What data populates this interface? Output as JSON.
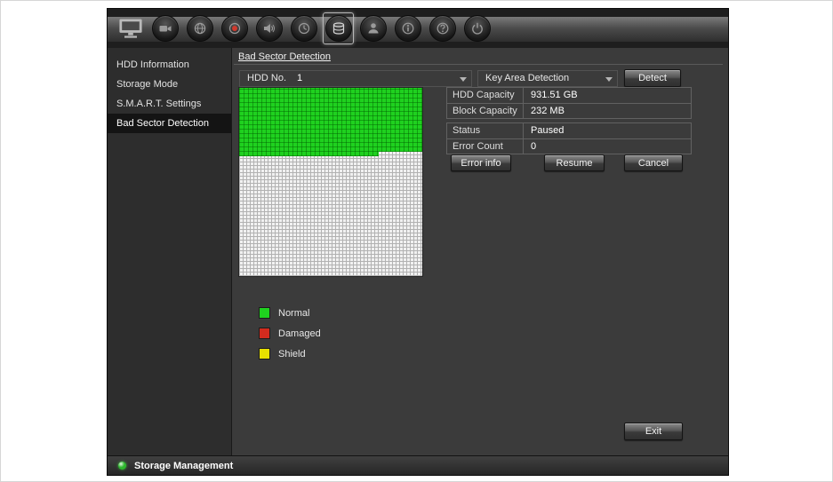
{
  "toolbar": {
    "icons": [
      "display-icon",
      "camera-icon",
      "network-icon",
      "record-icon",
      "alarm-icon",
      "system-icon",
      "storage-icon",
      "user-icon",
      "info-icon",
      "help-icon",
      "power-icon"
    ],
    "selected_icon": "storage-icon"
  },
  "sidebar": {
    "items": [
      {
        "label": "HDD Information",
        "selected": false
      },
      {
        "label": "Storage Mode",
        "selected": false
      },
      {
        "label": "S.M.A.R.T. Settings",
        "selected": false
      },
      {
        "label": "Bad Sector Detection",
        "selected": true
      }
    ]
  },
  "content": {
    "tab_title": "Bad Sector Detection",
    "hdd_row": {
      "label": "HDD No.",
      "value": "1",
      "detection_type": "Key Area Detection",
      "detect_button": "Detect"
    },
    "info": {
      "hdd_capacity_label": "HDD Capacity",
      "hdd_capacity_value": "931.51 GB",
      "block_capacity_label": "Block Capacity",
      "block_capacity_value": "232 MB",
      "status_label": "Status",
      "status_value": "Paused",
      "error_count_label": "Error Count",
      "error_count_value": "0"
    },
    "buttons": {
      "error_info": "Error info",
      "resume": "Resume",
      "cancel": "Cancel",
      "exit": "Exit"
    },
    "legend": [
      {
        "label": "Normal"
      },
      {
        "label": "Damaged"
      },
      {
        "label": "Shield"
      }
    ],
    "grid": {
      "scanned_percent": 34,
      "partial_row_percent": 76
    }
  },
  "colors": {
    "normal": "#1fd11f",
    "damaged": "#d42b1e",
    "shield": "#e8e000",
    "status_led": "#2db82d"
  },
  "statusbar": {
    "label": "Storage Management"
  }
}
